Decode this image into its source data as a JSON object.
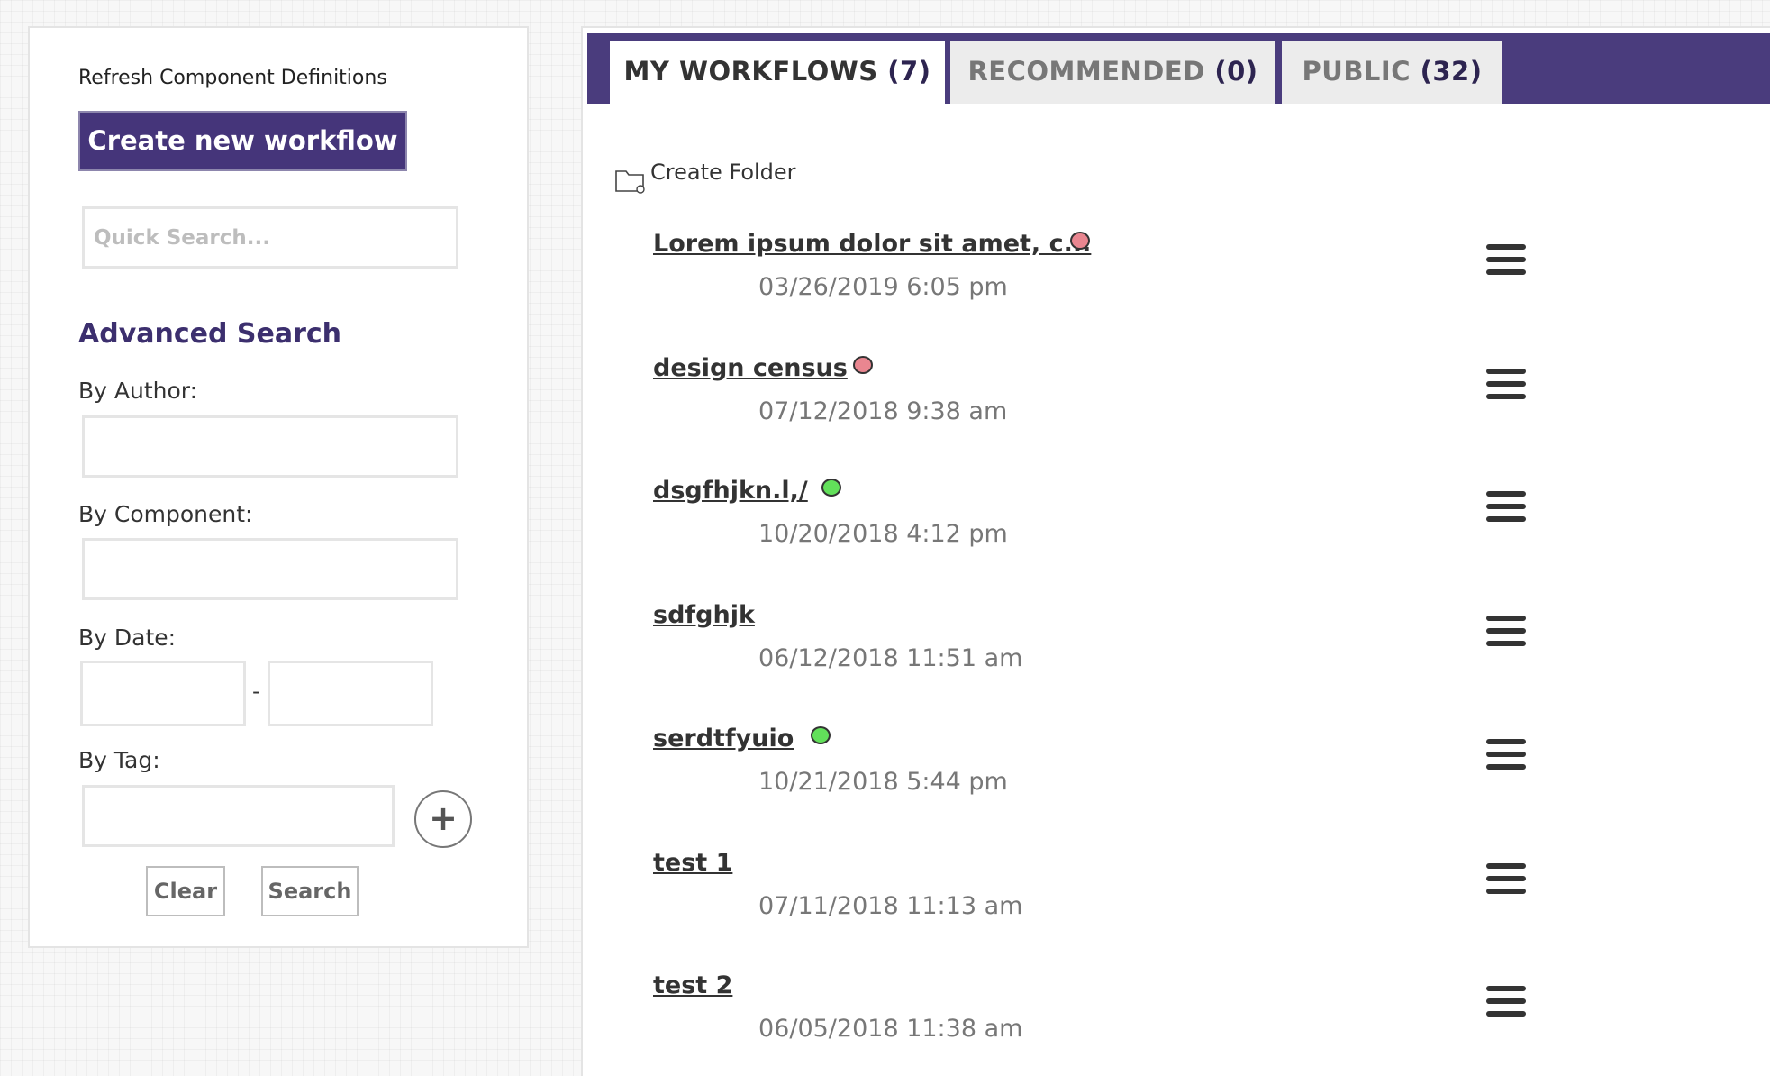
{
  "sidebar": {
    "refresh_label": "Refresh Component Definitions",
    "create_label": "Create new workflow",
    "quick_search_placeholder": "Quick Search...",
    "advanced_title": "Advanced Search",
    "by_author_label": "By Author:",
    "by_component_label": "By Component:",
    "by_date_label": "By Date:",
    "date_separator": "-",
    "by_tag_label": "By Tag:",
    "add_tag_symbol": "+",
    "clear_label": "Clear",
    "search_label": "Search"
  },
  "tabs": [
    {
      "label": "MY WORKFLOWS",
      "count": "(7)",
      "active": true
    },
    {
      "label": "RECOMMENDED",
      "count": "(0)",
      "active": false
    },
    {
      "label": "PUBLIC",
      "count": "(32)",
      "active": false
    }
  ],
  "main": {
    "create_folder_label": "Create Folder"
  },
  "workflows": [
    {
      "title": "Lorem ipsum dolor sit amet, c...",
      "date": "03/26/2019 6:05 pm",
      "status": "red"
    },
    {
      "title": "design census",
      "date": "07/12/2018 9:38 am",
      "status": "red"
    },
    {
      "title": "dsgfhjkn.l,/",
      "date": "10/20/2018 4:12 pm",
      "status": "green"
    },
    {
      "title": "sdfghjk",
      "date": "06/12/2018 11:51 am",
      "status": "none"
    },
    {
      "title": "serdtfyuio",
      "date": "10/21/2018 5:44 pm",
      "status": "green"
    },
    {
      "title": "test 1",
      "date": "07/11/2018 11:13 am",
      "status": "none"
    },
    {
      "title": "test 2",
      "date": "06/05/2018 11:38 am",
      "status": "none"
    }
  ],
  "colors": {
    "brand_purple": "#45357a",
    "tabbar_purple": "#4a3c7d",
    "heading_purple": "#3c2f6e",
    "status_red": "#e98690",
    "status_green": "#62e05a"
  }
}
